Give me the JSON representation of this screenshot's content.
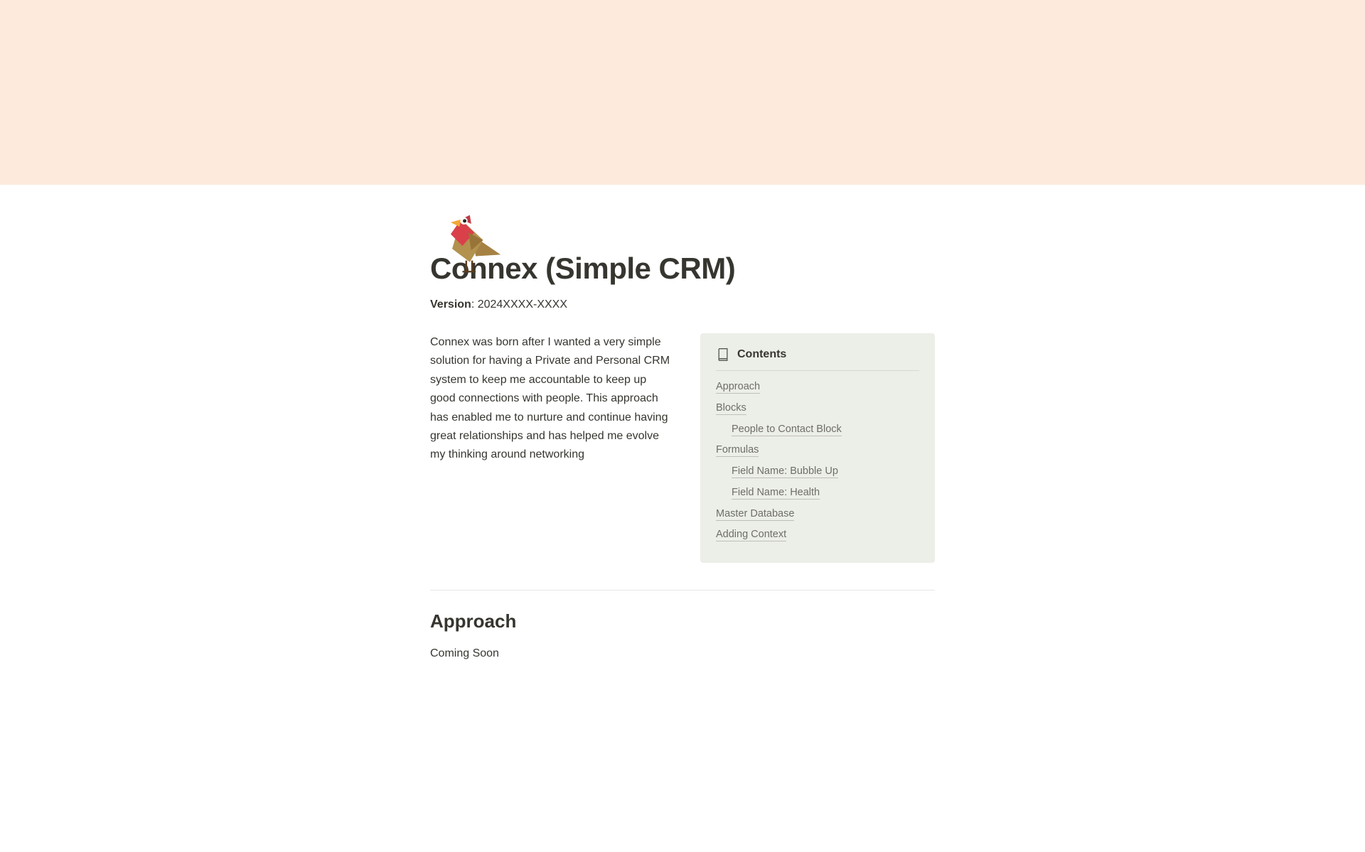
{
  "title": "Connex (Simple CRM)",
  "version": {
    "label": "Version",
    "value": "2024XXXX-XXXX"
  },
  "intro": "Connex was born after I wanted a very simple solution for having a Private and Personal CRM system to keep me accountable to keep up good connections with people. This approach has enabled me to nurture and continue having great relationships and has helped me evolve my thinking around networking",
  "toc": {
    "title": "Contents",
    "items": [
      {
        "label": "Approach",
        "indent": 0
      },
      {
        "label": "Blocks",
        "indent": 0
      },
      {
        "label": "People to Contact Block",
        "indent": 1
      },
      {
        "label": "Formulas",
        "indent": 0
      },
      {
        "label": "Field Name: Bubble Up",
        "indent": 1
      },
      {
        "label": "Field Name: Health",
        "indent": 1
      },
      {
        "label": "Master Database",
        "indent": 0
      },
      {
        "label": "Adding Context",
        "indent": 0
      }
    ]
  },
  "sections": {
    "approach": {
      "heading": "Approach",
      "body": "Coming Soon"
    }
  }
}
